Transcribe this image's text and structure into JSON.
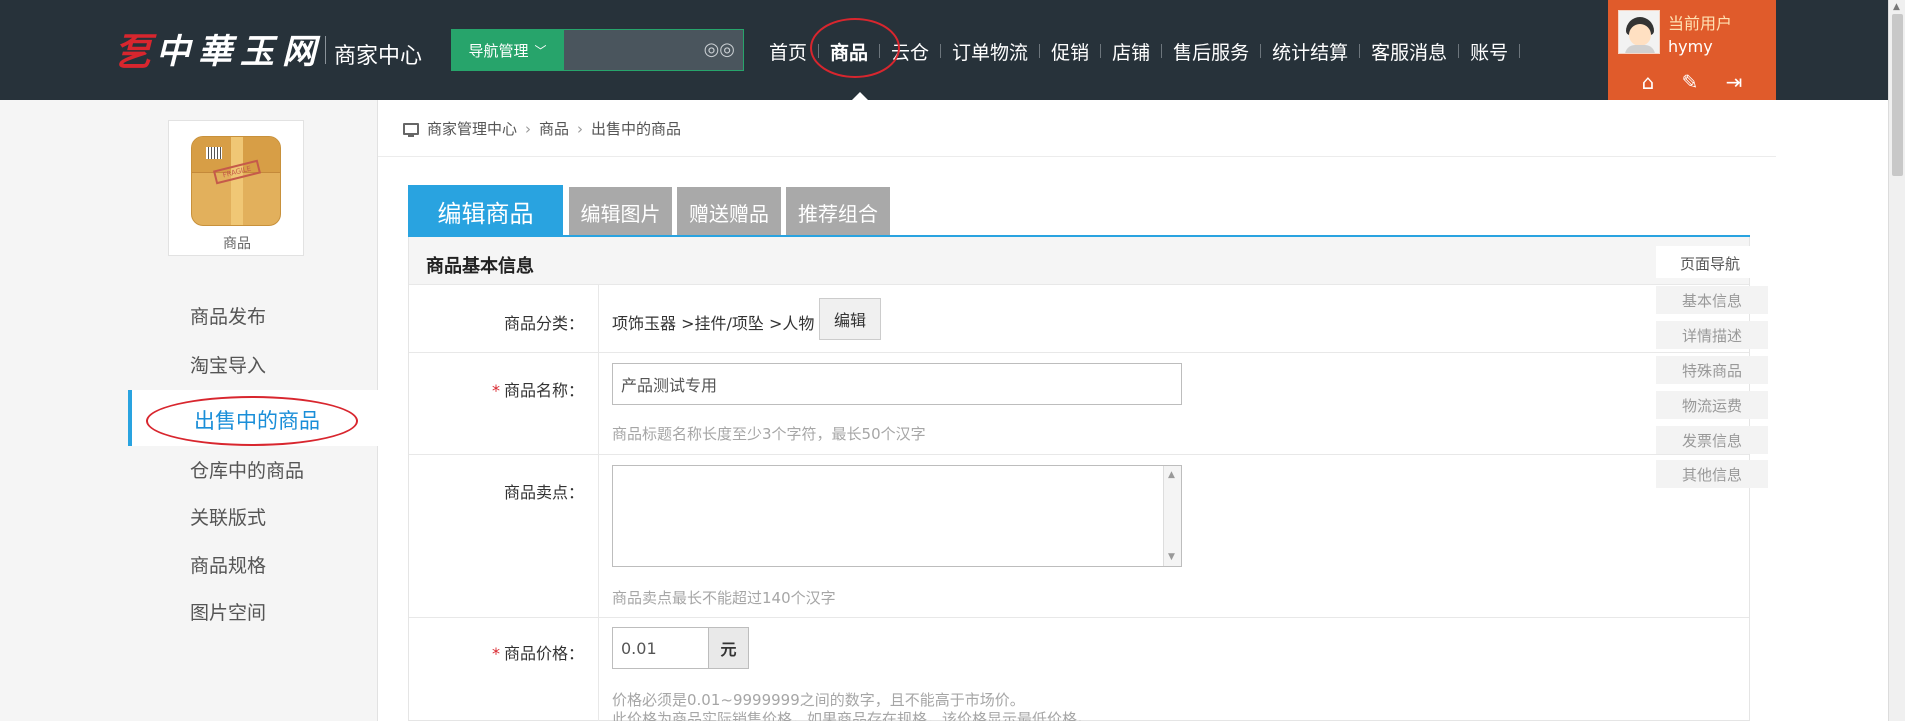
{
  "header": {
    "logo_mark": "乭",
    "logo_text": "中華玉网",
    "subtitle": "商家中心",
    "nav_manager_label": "导航管理",
    "search_placeholder": "",
    "nav_items": [
      "首页",
      "商品",
      "云仓",
      "订单物流",
      "促销",
      "店铺",
      "售后服务",
      "统计结算",
      "客服消息",
      "账号"
    ],
    "active_nav": "商品",
    "user_label": "当前用户",
    "user_name": "hymy"
  },
  "icons": {
    "home": "home-icon",
    "settings": "wrench-icon",
    "logout": "logout-icon",
    "search": "binoculars-icon",
    "breadcrumb": "monitor-icon"
  },
  "sidebar": {
    "category_label": "商品",
    "menu": [
      "商品发布",
      "淘宝导入",
      "出售中的商品",
      "仓库中的商品",
      "关联版式",
      "商品规格",
      "图片空间"
    ],
    "active": "出售中的商品"
  },
  "breadcrumb": [
    "商家管理中心",
    "商品",
    "出售中的商品"
  ],
  "tabs": [
    "编辑商品",
    "编辑图片",
    "赠送赠品",
    "推荐组合"
  ],
  "form": {
    "section_title": "商品基本信息",
    "category": {
      "label": "商品分类：",
      "value": "项饰玉器 >挂件/项坠 >人物",
      "edit_label": "编辑"
    },
    "name": {
      "label": "商品名称：",
      "value": "产品测试专用",
      "hint": "商品标题名称长度至少3个字符，最长50个汉字"
    },
    "selling_point": {
      "label": "商品卖点：",
      "value": "",
      "hint": "商品卖点最长不能超过140个汉字"
    },
    "price": {
      "label": "商品价格：",
      "value": "0.01",
      "unit": "元",
      "hint1": "价格必须是0.01~9999999之间的数字，且不能高于市场价。",
      "hint2": "此价格为商品实际销售价格，如果商品存在规格，该价格显示最低价格。"
    }
  },
  "page_nav": {
    "title": "页面导航",
    "items": [
      "基本信息",
      "详情描述",
      "特殊商品",
      "物流运费",
      "发票信息",
      "其他信息"
    ]
  },
  "colors": {
    "topbar": "#27323a",
    "accent_blue": "#29a3e0",
    "green": "#27a46b",
    "user_orange": "#e05b2b",
    "highlight_red": "#d8262e"
  }
}
